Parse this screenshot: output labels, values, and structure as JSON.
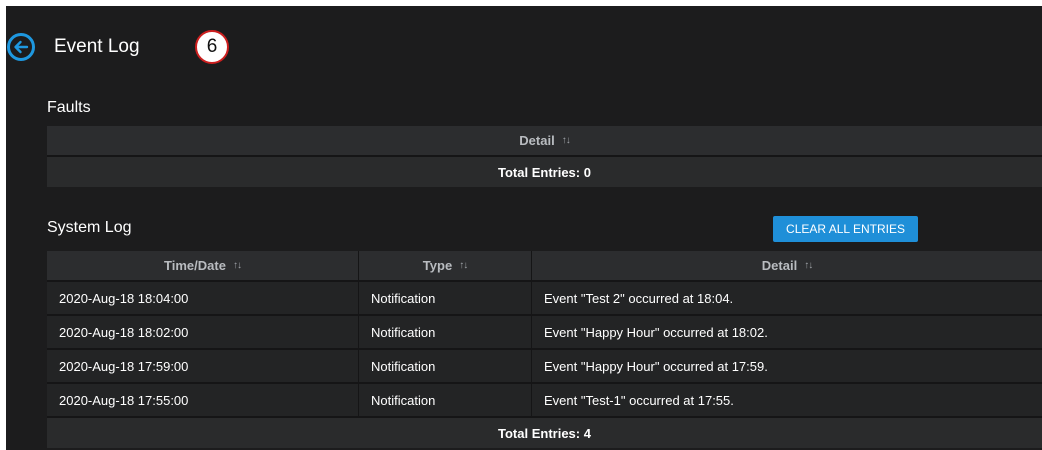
{
  "header": {
    "title": "Event Log",
    "step_badge": "6",
    "back_icon": "arrow-left-circle-icon"
  },
  "faults": {
    "title": "Faults",
    "columns": [
      "Detail"
    ],
    "total": "Total Entries: 0"
  },
  "system_log": {
    "title": "System Log",
    "clear_button": "CLEAR ALL ENTRIES",
    "columns": [
      "Time/Date",
      "Type",
      "Detail"
    ],
    "rows": [
      {
        "time": "2020-Aug-18 18:04:00",
        "type": "Notification",
        "detail": "Event \"Test 2\" occurred at 18:04."
      },
      {
        "time": "2020-Aug-18 18:02:00",
        "type": "Notification",
        "detail": "Event \"Happy Hour\" occurred at 18:02."
      },
      {
        "time": "2020-Aug-18 17:59:00",
        "type": "Notification",
        "detail": "Event \"Happy Hour\" occurred at 17:59."
      },
      {
        "time": "2020-Aug-18 17:55:00",
        "type": "Notification",
        "detail": "Event \"Test-1\" occurred at 17:55."
      }
    ],
    "total": "Total Entries: 4"
  },
  "colors": {
    "background": "#1c1c1d",
    "accent": "#1f8fd8",
    "badge_border": "#cc1f1f"
  },
  "sort_icon": "↑↓"
}
